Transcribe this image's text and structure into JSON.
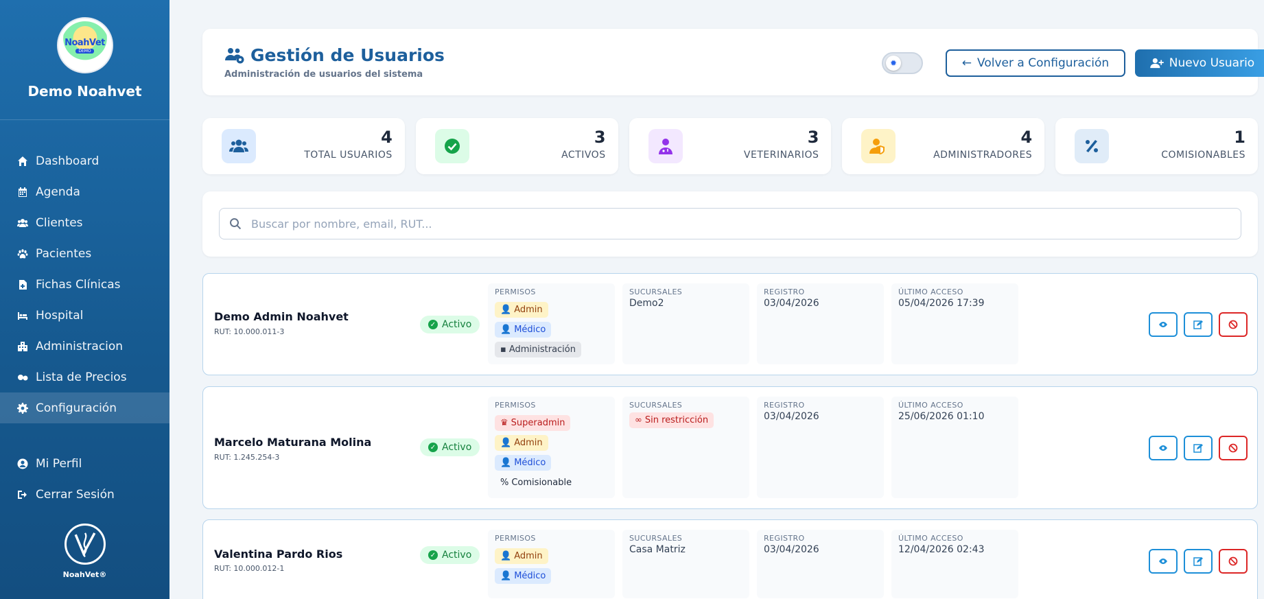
{
  "brand": {
    "name": "Demo Noahvet",
    "logo_text": "NoahVet",
    "logo_sub": "DEMO",
    "footer_label": "NoahVet®"
  },
  "sidebar": {
    "items": [
      {
        "label": "Dashboard",
        "icon": "home-icon"
      },
      {
        "label": "Agenda",
        "icon": "calendar-icon"
      },
      {
        "label": "Clientes",
        "icon": "users-icon"
      },
      {
        "label": "Pacientes",
        "icon": "paw-icon"
      },
      {
        "label": "Fichas Clínicas",
        "icon": "file-medical-icon"
      },
      {
        "label": "Hospital",
        "icon": "hospital-bed-icon"
      },
      {
        "label": "Administracion",
        "icon": "building-icon"
      },
      {
        "label": "Lista de Precios",
        "icon": "pills-icon"
      },
      {
        "label": "Configuración",
        "icon": "gear-icon",
        "active": true
      }
    ],
    "bottom_items": [
      {
        "label": "Mi Perfil",
        "icon": "user-circle-icon"
      },
      {
        "label": "Cerrar Sesión",
        "icon": "logout-icon"
      }
    ]
  },
  "header": {
    "title": "Gestión de Usuarios",
    "subtitle": "Administración de usuarios del sistema",
    "back_label": "Volver a Configuración",
    "new_label": "Nuevo Usuario"
  },
  "stats": [
    {
      "value": "4",
      "label": "TOTAL USUARIOS",
      "color": "#1d5f9c",
      "bg": "#dbeafe"
    },
    {
      "value": "3",
      "label": "ACTIVOS",
      "color": "#16a34a",
      "bg": "#dcfce7"
    },
    {
      "value": "3",
      "label": "VETERINARIOS",
      "color": "#9333ea",
      "bg": "#f3e8ff"
    },
    {
      "value": "4",
      "label": "ADMINISTRADORES",
      "color": "#f59e0b",
      "bg": "#fef3c7"
    },
    {
      "value": "1",
      "label": "COMISIONABLES",
      "color": "#1d5f9c",
      "bg": "#e0ecf8"
    }
  ],
  "search": {
    "placeholder": "Buscar por nombre, email, RUT..."
  },
  "columns": {
    "permisos": "PERMISOS",
    "sucursales": "SUCURSALES",
    "registro": "REGISTRO",
    "ultimo_acceso": "ÚLTIMO ACCESO"
  },
  "users": [
    {
      "name": "Demo Admin Noahvet",
      "rut": "RUT: 10.000.011-3",
      "status": "Activo",
      "permisos": [
        "Admin",
        "Médico",
        "Administración"
      ],
      "sucursales": "Demo2",
      "registro": "03/04/2026",
      "ultimo_acceso": "05/04/2026 17:39"
    },
    {
      "name": "Marcelo Maturana Molina",
      "rut": "RUT: 1.245.254-3",
      "status": "Activo",
      "permisos": [
        "Superadmin",
        "Admin",
        "Médico",
        "Comisionable"
      ],
      "sucursales_chip": "Sin restricción",
      "registro": "03/04/2026",
      "ultimo_acceso": "25/06/2026 01:10"
    },
    {
      "name": "Valentina Pardo Rios",
      "rut": "RUT: 10.000.012-1",
      "status": "Activo",
      "permisos": [
        "Admin",
        "Médico"
      ],
      "sucursales": "Casa Matriz",
      "registro": "03/04/2026",
      "ultimo_acceso": "12/04/2026 02:43"
    }
  ]
}
